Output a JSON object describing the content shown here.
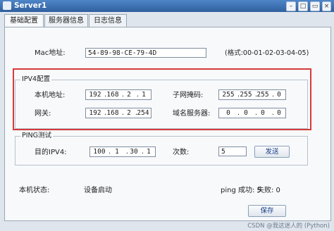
{
  "window": {
    "title": "Server1"
  },
  "tabs": [
    "基础配置",
    "服务器信息",
    "日志信息"
  ],
  "mac": {
    "label": "Mac地址:",
    "value": "54-89-98-CE-79-4D",
    "format": "(格式:00-01-02-03-04-05)"
  },
  "ipv4": {
    "legend": "IPV4配置",
    "local_ip": {
      "label": "本机地址:",
      "octets": [
        "192",
        "168",
        "2",
        "1"
      ]
    },
    "subnet": {
      "label": "子网掩码:",
      "octets": [
        "255",
        "255",
        "255",
        "0"
      ]
    },
    "gateway": {
      "label": "网关:",
      "octets": [
        "192",
        "168",
        "2",
        "254"
      ]
    },
    "dns": {
      "label": "域名服务器:",
      "octets": [
        "0",
        "0",
        "0",
        "0"
      ]
    }
  },
  "ping": {
    "legend": "PING测试",
    "target": {
      "label": "目的IPV4:",
      "octets": [
        "100",
        "1",
        "30",
        "1"
      ]
    },
    "count": {
      "label": "次数:",
      "value": "5"
    },
    "send_label": "发送"
  },
  "status": {
    "label": "本机状态:",
    "value": "设备启动",
    "ping_success": "ping 成功: 5",
    "fail": "失败: 0"
  },
  "save_label": "保存",
  "watermark": "CSDN @我这迷人的 (Python)",
  "colors": {
    "highlight_border": "#d63a3a",
    "titlebar": "#2f5f9e"
  }
}
